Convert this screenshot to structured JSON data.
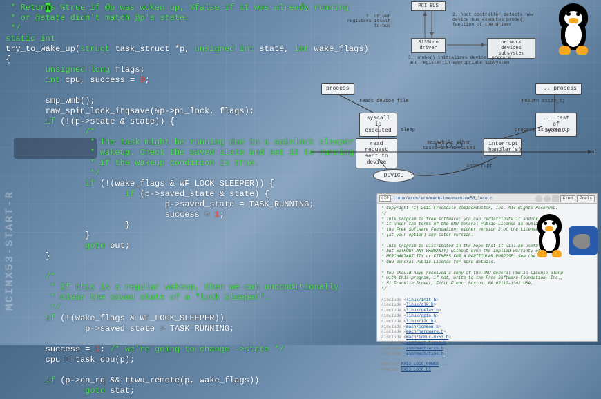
{
  "code": {
    "lines": [
      {
        "indent": " * ",
        "t": "Retur",
        "cursor": "n",
        "rest": "s %true if @p was woken up, %false if it was already running",
        "cls": "cm"
      },
      {
        "indent": " * ",
        "t": "or @state didn't match @p's state.",
        "cls": "cm"
      },
      {
        "indent": " ",
        "t": "*/",
        "cls": "cm"
      },
      {
        "indent": "",
        "t": "static int",
        "cls": "kw"
      },
      {
        "indent": "",
        "raw": "try_to_wake_up(<span class=kw>struct</span> task_struct *p, <span class=kw>unsigned int</span> state, <span class=kw>int</span> wake_flags)"
      },
      {
        "indent": "",
        "t": "{"
      },
      {
        "indent": "        ",
        "raw": "<span class=kw>unsigned long</span> flags;"
      },
      {
        "indent": "        ",
        "raw": "<span class=kw>int</span> cpu, success = <span class=nu>0</span>;"
      },
      {
        "indent": "",
        "t": ""
      },
      {
        "indent": "        ",
        "t": "smp_wmb();"
      },
      {
        "indent": "        ",
        "t": "raw_spin_lock_irqsave(&p->pi_lock, flags);"
      },
      {
        "indent": "        ",
        "raw": "<span class=kw>if</span> (!(p->state & state)) {"
      },
      {
        "indent": "                ",
        "t": "/*",
        "cls": "cm"
      },
      {
        "indent": "                 ",
        "t": "* The task might be running due to a spinlock sleeper",
        "cls": "cm"
      },
      {
        "indent": "                 ",
        "t": "* wakeup. Check the saved state and set it to running",
        "cls": "cm"
      },
      {
        "indent": "                 ",
        "t": "* if the wakeup condition is true.",
        "cls": "cm"
      },
      {
        "indent": "                 ",
        "t": "*/",
        "cls": "cm"
      },
      {
        "indent": "                ",
        "raw": "<span class=kw>if</span> (!(wake_flags & WF_LOCK_SLEEPER)) {"
      },
      {
        "indent": "                        ",
        "raw": "<span class=kw>if</span> (p->saved_state & state) {"
      },
      {
        "indent": "                                ",
        "t": "p->saved_state = TASK_RUNNING;"
      },
      {
        "indent": "                                ",
        "raw": "success = <span class=nu>1</span>;"
      },
      {
        "indent": "                        ",
        "t": "}"
      },
      {
        "indent": "                ",
        "t": "}"
      },
      {
        "indent": "                ",
        "raw": "<span class=kw>goto</span> out;"
      },
      {
        "indent": "        ",
        "t": "}"
      },
      {
        "indent": "",
        "t": ""
      },
      {
        "indent": "        ",
        "t": "/*",
        "cls": "cm"
      },
      {
        "indent": "         ",
        "t": "* If this is a regular wakeup, then we can unconditionally",
        "cls": "cm"
      },
      {
        "indent": "         ",
        "t": "* clear the saved state of a \"lock sleeper\".",
        "cls": "cm"
      },
      {
        "indent": "         ",
        "t": "*/",
        "cls": "cm"
      },
      {
        "indent": "        ",
        "raw": "<span class=kw>if</span> (!(wake_flags & WF_LOCK_SLEEPER))"
      },
      {
        "indent": "                ",
        "t": "p->saved_state = TASK_RUNNING;"
      },
      {
        "indent": "",
        "t": ""
      },
      {
        "indent": "        ",
        "raw": "success = <span class=nu>1</span>; <span class=cm>/* we're going to change ->state */</span>"
      },
      {
        "indent": "        ",
        "t": "cpu = task_cpu(p);"
      },
      {
        "indent": "",
        "t": ""
      },
      {
        "indent": "        ",
        "raw": "<span class=kw>if</span> (p->on_rq && ttwu_remote(p, wake_flags))"
      },
      {
        "indent": "                ",
        "raw": "<span class=kw>goto</span> stat;"
      }
    ]
  },
  "diag1": {
    "pci_bus": "PCI BUS",
    "note1": "1. driver\nregisters itself\nto bus",
    "note2": "2. host controller detects new device\nbus executes probe() function of\nthe driver",
    "driver": "8139too\ndriver",
    "subsys": "network devices\nsubsystem",
    "note3": "3. probe() initializes\ndevice, prepare\nand register in appropriate subsystem"
  },
  "diag2": {
    "process": "process",
    "process2": "... process",
    "reads": "reads device file",
    "return": "return ssize_t;",
    "syscall": "syscall\nis executed",
    "rest": "... rest of\nsyscall",
    "sleep": "sleep",
    "woken": "process is woken up",
    "read_req": "read\nrequest\nsent to device",
    "meanwhile": "meanwhile other tasks\nare executed",
    "interrupt_h": "interrupt\nhandler(s)",
    "device": "DEVICE",
    "interrupt": "interrupt",
    "t": "t"
  },
  "browser": {
    "lxr": "LXR",
    "path": "linux/arch/arm/mach-imx/mach-mx53_loco.c",
    "tabs": [
      "Find",
      "Prefs"
    ],
    "header": "* Copyright (C) 2011 Freescale Semiconductor, Inc. All Rights Reserved.",
    "license": [
      "*/",
      "* This program is free software; you can redistribute it and/or modify",
      "* it under the terms of the GNU General Public License as published by",
      "* the Free Software Foundation; either version 2 of the License, or",
      "* (at your option) any later version.",
      "",
      "* This program is distributed in the hope that it will be useful,",
      "* but WITHOUT ANY WARRANTY; without even the implied warranty of",
      "* MERCHANTABILITY or FITNESS FOR A PARTICULAR PURPOSE.  See the",
      "* GNU General Public License for more details.",
      "",
      "* You should have received a copy of the GNU General Public License along",
      "* with this program; if not, write to the Free Software Foundation, Inc.,",
      "* 51 Franklin Street, Fifth Floor, Boston, MA 02110-1301 USA.",
      "*/"
    ],
    "includes": [
      "linux/init.h",
      "linux/clk.h",
      "linux/delay.h",
      "linux/gpio.h",
      "linux/i2c.h",
      "mach/common.h",
      "mach/hardware.h",
      "mach/iomux-mx53.h",
      "asm/mach-types.h",
      "asm/mach/arch.h",
      "asm/mach/time.h"
    ],
    "defines": [
      "MX53_LOCO_POWER",
      "MX53_LOCO_UI"
    ]
  }
}
